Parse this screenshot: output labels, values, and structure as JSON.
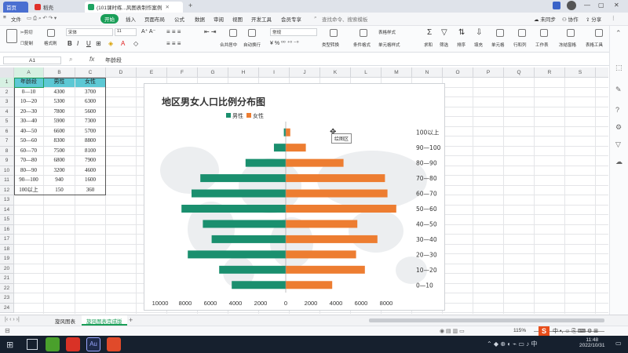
{
  "tabs": {
    "home": "首页",
    "docer": "稻壳",
    "file": "(101课时练...风图表制作案例"
  },
  "menu": {
    "file": "文件",
    "start": "开始",
    "insert": "插入",
    "layout": "页面布局",
    "formula": "公式",
    "data": "数据",
    "review": "审阅",
    "view": "视图",
    "dev": "开发工具",
    "vip": "会员专享",
    "search": "查找命令、搜索模板",
    "sync": "未同步",
    "collab": "协作",
    "share": "分享"
  },
  "ribbon": {
    "cut": "剪切",
    "copy": "复制",
    "painter": "格式刷",
    "font": "宋体",
    "size": "11",
    "merge": "合并居中",
    "wrap": "自动换行",
    "numfmt": "常规",
    "typeconv": "类型转换",
    "condfmt": "条件格式",
    "tablestyle": "表格样式",
    "cellstyle": "单元格样式",
    "sum": "求和",
    "filter": "筛选",
    "sort": "排序",
    "fill": "填充",
    "cell": "单元格",
    "rowcol": "行和列",
    "sheet": "工作表",
    "freeze": "冻结窗格",
    "tabletool": "表格工具"
  },
  "formula_bar": {
    "name_box": "A1",
    "fx": "fx",
    "content": "年龄段"
  },
  "columns": [
    "A",
    "B",
    "C",
    "D",
    "E",
    "F",
    "G",
    "H",
    "I",
    "J",
    "K",
    "L",
    "M",
    "N",
    "O",
    "P",
    "Q",
    "R",
    "S"
  ],
  "rows": [
    "1",
    "2",
    "3",
    "4",
    "5",
    "6",
    "7",
    "8",
    "9",
    "10",
    "11",
    "12",
    "13",
    "14",
    "15",
    "16",
    "17",
    "18",
    "19",
    "20",
    "21",
    "22",
    "23",
    "24"
  ],
  "table": {
    "headers": [
      "年龄段",
      "男性",
      "女性"
    ],
    "rows": [
      [
        "0—10",
        "4300",
        "3700"
      ],
      [
        "10—20",
        "5300",
        "6300"
      ],
      [
        "20—30",
        "7800",
        "5600"
      ],
      [
        "30—40",
        "5900",
        "7300"
      ],
      [
        "40—50",
        "6600",
        "5700"
      ],
      [
        "50—60",
        "8300",
        "8800"
      ],
      [
        "60—70",
        "7500",
        "8100"
      ],
      [
        "70—80",
        "6800",
        "7900"
      ],
      [
        "80—90",
        "3200",
        "4600"
      ],
      [
        "90—100",
        "940",
        "1600"
      ],
      [
        "100以上",
        "150",
        "360"
      ]
    ]
  },
  "chart_data": {
    "type": "bar",
    "title": "地区男女人口比例分布图",
    "categories": [
      "0—10",
      "10—20",
      "20—30",
      "30—40",
      "40—50",
      "50—60",
      "60—70",
      "70—80",
      "80—90",
      "90—100",
      "100以上"
    ],
    "series": [
      {
        "name": "男性",
        "values": [
          4300,
          5300,
          7800,
          5900,
          6600,
          8300,
          7500,
          6800,
          3200,
          940,
          150
        ],
        "color": "#1a8f6e"
      },
      {
        "name": "女性",
        "values": [
          3700,
          6300,
          5600,
          7300,
          5700,
          8800,
          8100,
          7900,
          4600,
          1600,
          360
        ],
        "color": "#ed7d31"
      }
    ],
    "xticks": [
      "10000",
      "8000",
      "6000",
      "4000",
      "2000",
      "0",
      "2000",
      "4000",
      "6000",
      "8000"
    ],
    "xlim": [
      -10000,
      10000
    ],
    "legend": "top-left",
    "tooltip": "绘图区"
  },
  "sheets": [
    "旋风图表",
    "旋风图表完成版"
  ],
  "status": {
    "zoom": "115%",
    "time": "11:48",
    "date": "2022/10/31"
  }
}
